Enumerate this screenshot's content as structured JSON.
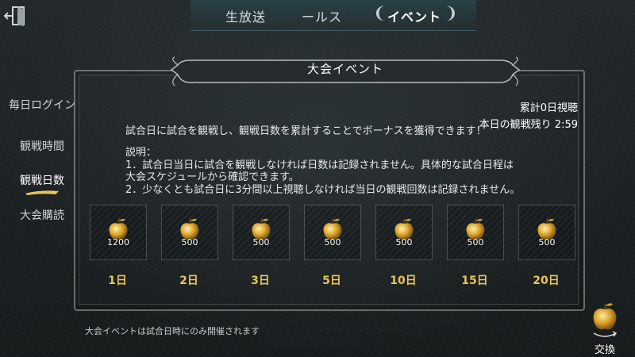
{
  "nav": {
    "tabs": [
      {
        "label": "生放送"
      },
      {
        "label": "ールス"
      },
      {
        "label": "イベント"
      }
    ]
  },
  "sidebar": {
    "items": [
      {
        "label": "毎日ログイン"
      },
      {
        "label": "観戦時間"
      },
      {
        "label": "観戦日数"
      },
      {
        "label": "大会購読"
      }
    ]
  },
  "panel": {
    "title": "大会イベント",
    "total_days": "累計0日視聴",
    "remaining": "本日の観戦残り 2:59",
    "intro": "試合日に試合を観戦し、観戦日数を累計することでボーナスを獲得できます！",
    "explain_heading": "説明：",
    "rule1_line1": "1．試合日当日に試合を観戦しなければ日数は記録されません。具体的な試合日程は",
    "rule1_line2": "大会スケジュールから確認できます。",
    "rule2": "2．少なくとも試合日に3分間以上視聴しなければ当日の観戦回数は記録されません。"
  },
  "rewards": [
    {
      "amount": "1200",
      "day": "1日"
    },
    {
      "amount": "500",
      "day": "2日"
    },
    {
      "amount": "500",
      "day": "3日"
    },
    {
      "amount": "500",
      "day": "5日"
    },
    {
      "amount": "500",
      "day": "10日"
    },
    {
      "amount": "500",
      "day": "15日"
    },
    {
      "amount": "500",
      "day": "20日"
    }
  ],
  "footer": {
    "note": "大会イベントは試合日時にのみ開催されます",
    "exchange_label": "交換"
  },
  "colors": {
    "accent_gold": "#e8c55a",
    "background": "#1c2022"
  }
}
